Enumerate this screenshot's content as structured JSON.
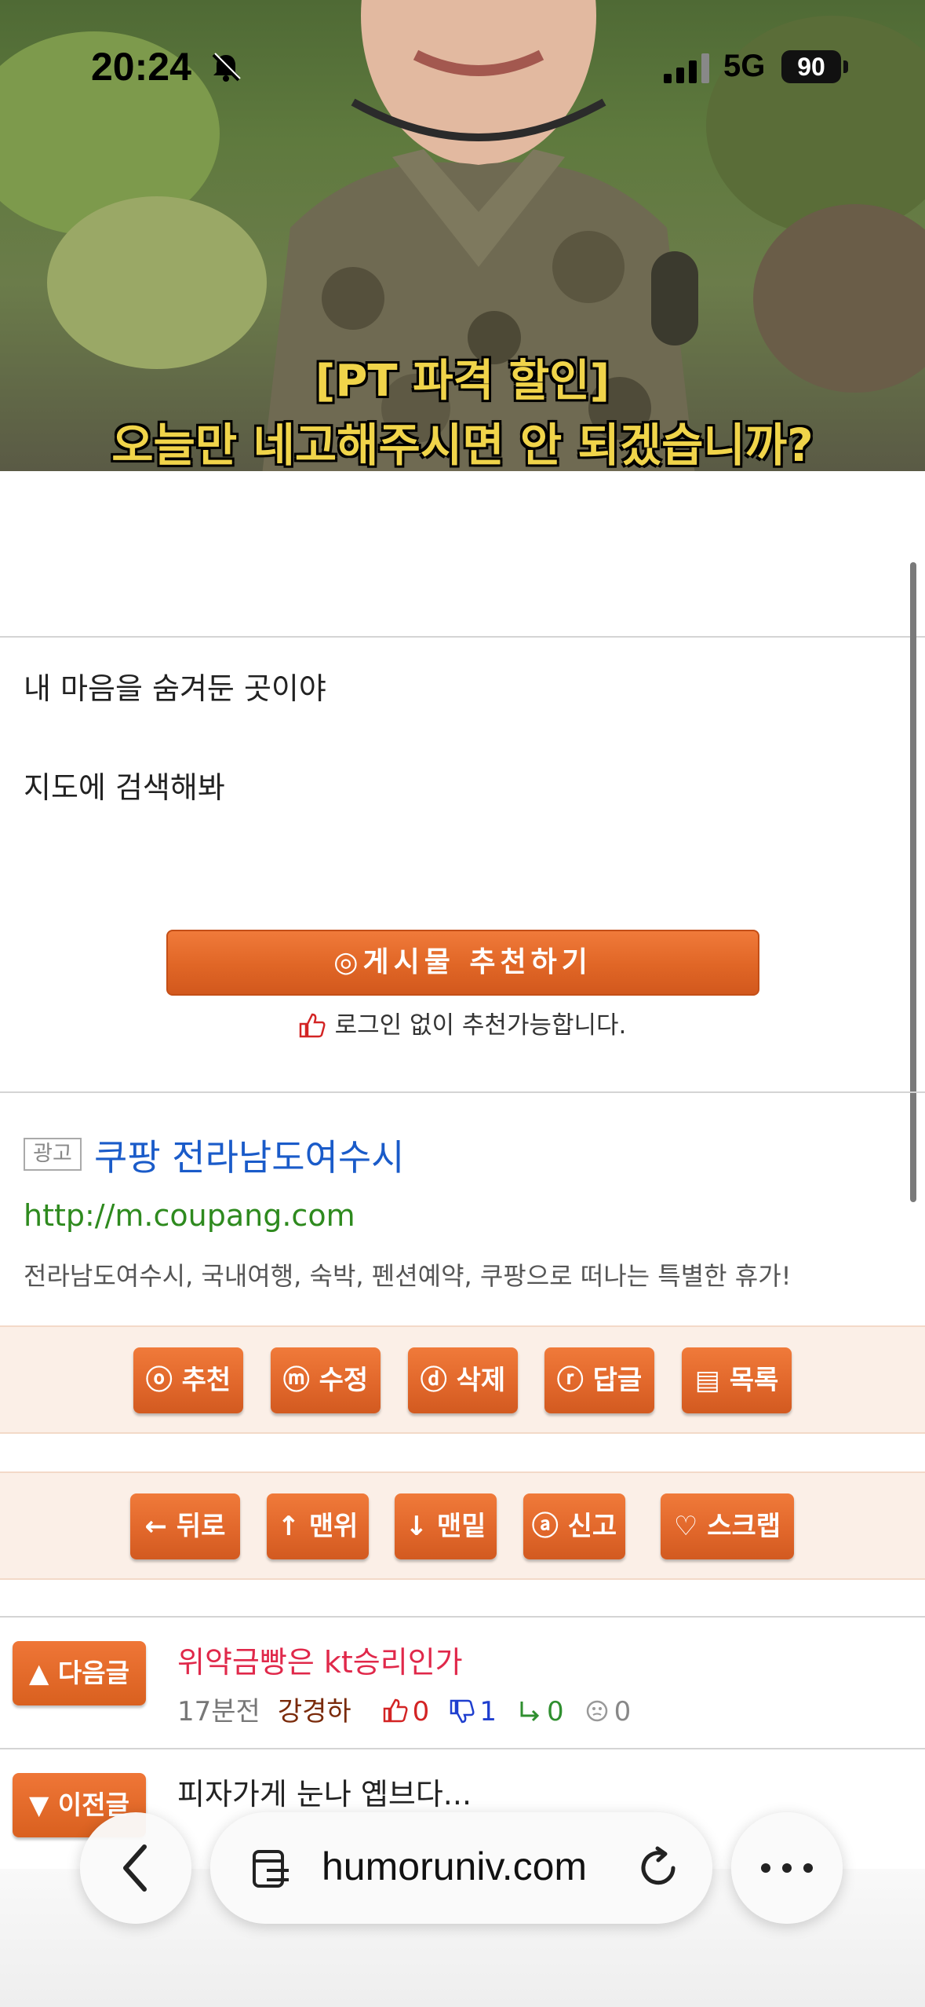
{
  "status_bar": {
    "time": "20:24",
    "network": "5G",
    "battery": "90",
    "icons": [
      "bell-slash-icon",
      "signal-icon",
      "battery-icon"
    ]
  },
  "hero": {
    "caption_line1": "[PT 파격 할인]",
    "caption_line2": "오늘만 네고해주시면 안 되겠습니까?"
  },
  "post": {
    "lines": [
      "내 마음을 숨겨둔 곳이야",
      "지도에 검색해봐"
    ],
    "recommend_button": "◎게시물  추천하기",
    "recommend_note": "로그인 없이 추천가능합니다."
  },
  "ad": {
    "badge": "광고",
    "title": "쿠팡 전라남도여수시",
    "url": "http://m.coupang.com",
    "description": "전라남도여수시, 국내여행, 숙박, 펜션예약, 쿠팡으로 떠나는 특별한 휴가!"
  },
  "action_buttons": [
    "ⓞ 추천",
    "ⓜ 수정",
    "ⓓ 삭제",
    "ⓡ 답글",
    "▤ 목록"
  ],
  "nav_buttons": [
    "← 뒤로",
    "↑ 맨위",
    "↓ 맨밑",
    "ⓐ 신고",
    "♡ 스크랩"
  ],
  "adjacent_posts": {
    "next": {
      "label": "▲ 다음글",
      "title": "위약금빵은 kt승리인가",
      "time": "17분전",
      "author": "강경하",
      "up": "0",
      "down": "1",
      "replies": "0",
      "neutral": "0"
    },
    "prev": {
      "label": "▼ 이전글",
      "title": "피자가게 눈나 옙브다..."
    }
  },
  "browser": {
    "url": "humoruniv.com",
    "icons": [
      "back-chevron-icon",
      "reader-icon",
      "reload-icon",
      "more-icon"
    ]
  },
  "colors": {
    "accent_orange": "#e0662a",
    "link_blue": "#1a5bc9",
    "url_green": "#2e8a1e",
    "next_title_red": "#e0284a"
  }
}
